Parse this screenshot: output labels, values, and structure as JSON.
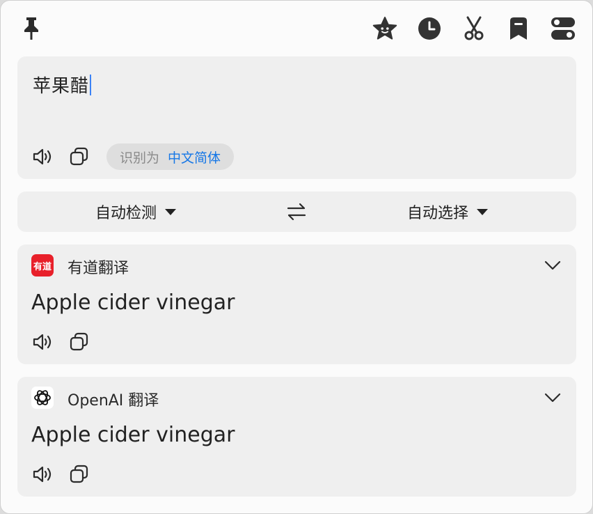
{
  "toolbar": {
    "icons": [
      "pin-icon",
      "star-icon",
      "history-icon",
      "scissors-icon",
      "bookmark-icon",
      "toggle-icon"
    ]
  },
  "input": {
    "text": "苹果醋",
    "detect_prefix": "识别为",
    "detect_lang": "中文简体"
  },
  "lang_bar": {
    "source": "自动检测",
    "target": "自动选择"
  },
  "results": [
    {
      "service": "有道翻译",
      "logo_text": "有道",
      "text": "Apple cider vinegar"
    },
    {
      "service": "OpenAI 翻译",
      "text": "Apple cider vinegar"
    }
  ],
  "colors": {
    "accent": "#1677e6",
    "youdao_red": "#e8202a",
    "card_bg": "#efefef"
  }
}
